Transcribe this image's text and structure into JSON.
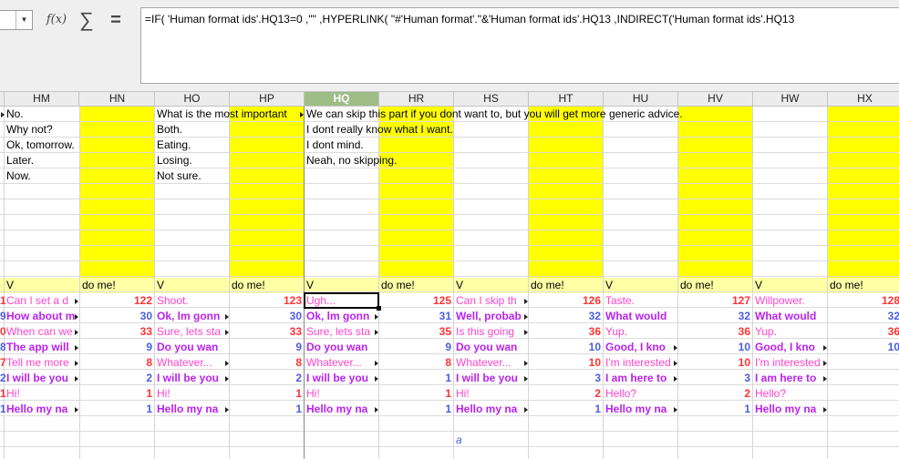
{
  "formula_bar": {
    "fx_label": "f(x)",
    "sigma_label": "∑",
    "equals_label": "=",
    "formula": "=IF(  'Human format ids'.HQ13=0  ,\"\"  ,HYPERLINK(   \"#'Human format'.\"&'Human format ids'.HQ13   ,INDIRECT('Human format ids'.HQ13"
  },
  "columns": [
    "HM",
    "HN",
    "HO",
    "HP",
    "HQ",
    "HR",
    "HS",
    "HT",
    "HU",
    "HV",
    "HW",
    "HX"
  ],
  "selected_column": "HQ",
  "top_text": {
    "hm": [
      "No.",
      "Why not?",
      "Ok, tomorrow.",
      "Later.",
      "Now."
    ],
    "ho": [
      "What is the most important",
      "Both.",
      "Eating.",
      "Losing.",
      "Not sure."
    ],
    "hq": [
      "We can skip this part if you dont want to, but you will get more generic advice.",
      "I dont really know what I want.",
      "I dont mind.",
      "Neah, no skipping."
    ]
  },
  "band_row": [
    "V",
    "do me!",
    "V",
    "do me!",
    "V",
    "do me!",
    "V",
    "do me!",
    "V",
    "do me!",
    "V",
    "do me!"
  ],
  "lower_rows": [
    {
      "cells": [
        "Can I set a d",
        "122",
        "Shoot.",
        "123",
        "Ugh...",
        "125",
        "Can I skip th",
        "126",
        "Taste.",
        "127",
        "Willpower.",
        "128"
      ],
      "numclass": "red",
      "left": "1",
      "leftclass": "red"
    },
    {
      "cells": [
        "How about m",
        "30",
        "Ok, lm gonn",
        "30",
        "Ok, lm gonn",
        "31",
        "Well, probab",
        "32",
        "What would",
        "32",
        "What would",
        "32"
      ],
      "numclass": "blue",
      "left": "9",
      "leftclass": "blue"
    },
    {
      "cells": [
        "When can we",
        "33",
        "Sure, lets sta",
        "33",
        "Sure, lets sta",
        "35",
        "Is this going",
        "36",
        "Yup.",
        "36",
        "Yup.",
        "36"
      ],
      "numclass": "red",
      "left": "0",
      "leftclass": "red"
    },
    {
      "cells": [
        "The app will",
        "9",
        "Do you wan",
        "9",
        "Do you wan",
        "9",
        "Do you wan",
        "10",
        "Good, I kno",
        "10",
        "Good, I kno",
        "10"
      ],
      "numclass": "blue",
      "left": "8",
      "leftclass": "blue"
    },
    {
      "cells": [
        "Tell me more",
        "8",
        "Whatever...",
        "8",
        "Whatever...",
        "8",
        "Whatever...",
        "10",
        "I'm interested",
        "10",
        "I'm interested",
        ""
      ],
      "numclass": "red",
      "left": "7",
      "leftclass": "red"
    },
    {
      "cells": [
        "I will be you",
        "2",
        "I will be you",
        "2",
        "I will be you",
        "1",
        "I will be you",
        "3",
        "I am here to",
        "3",
        "I am here to",
        ""
      ],
      "numclass": "blue",
      "left": "2",
      "leftclass": "blue"
    },
    {
      "cells": [
        "Hi!",
        "1",
        "Hi!",
        "1",
        "Hi!",
        "1",
        "Hi!",
        "2",
        "Hello?",
        "2",
        "Hello?",
        ""
      ],
      "numclass": "red",
      "left": "1",
      "leftclass": "red"
    },
    {
      "cells": [
        "Hello my na",
        "1",
        "Hello my na",
        "1",
        "Hello my na",
        "1",
        "Hello my na",
        "1",
        "Hello my na",
        "1",
        "Hello my na",
        ""
      ],
      "numclass": "blue",
      "left": "1",
      "leftclass": "blue"
    }
  ],
  "stray_text": "a"
}
